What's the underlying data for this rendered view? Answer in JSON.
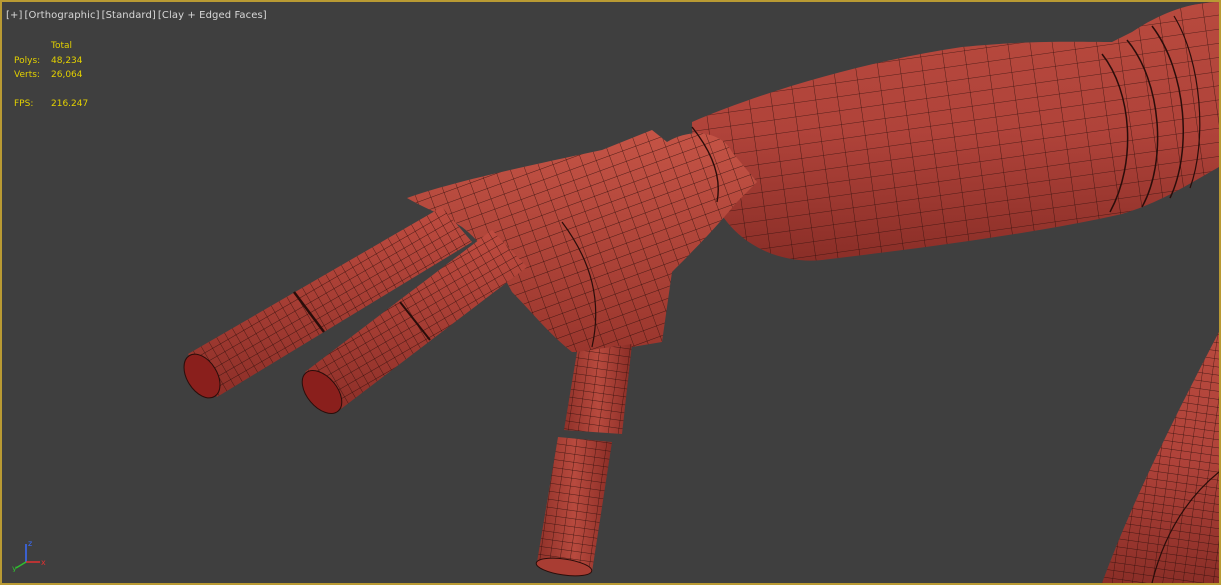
{
  "viewport": {
    "labels": [
      "[+]",
      "[Orthographic]",
      "[Standard]",
      "[Clay + Edged Faces]"
    ],
    "stats": {
      "header": "Total",
      "polys_label": "Polys:",
      "polys_value": "48,234",
      "verts_label": "Verts:",
      "verts_value": "26,064",
      "fps_label": "FPS:",
      "fps_value": "216.247"
    },
    "gizmo": {
      "x": "x",
      "y": "y",
      "z": "z"
    }
  },
  "colors": {
    "background": "#3f3f3f",
    "active_border": "#b99a33",
    "clay": "#b8453a",
    "edge": "#2a0d0a",
    "stats_text": "#e3d100",
    "label_text": "#d8d8d8"
  }
}
